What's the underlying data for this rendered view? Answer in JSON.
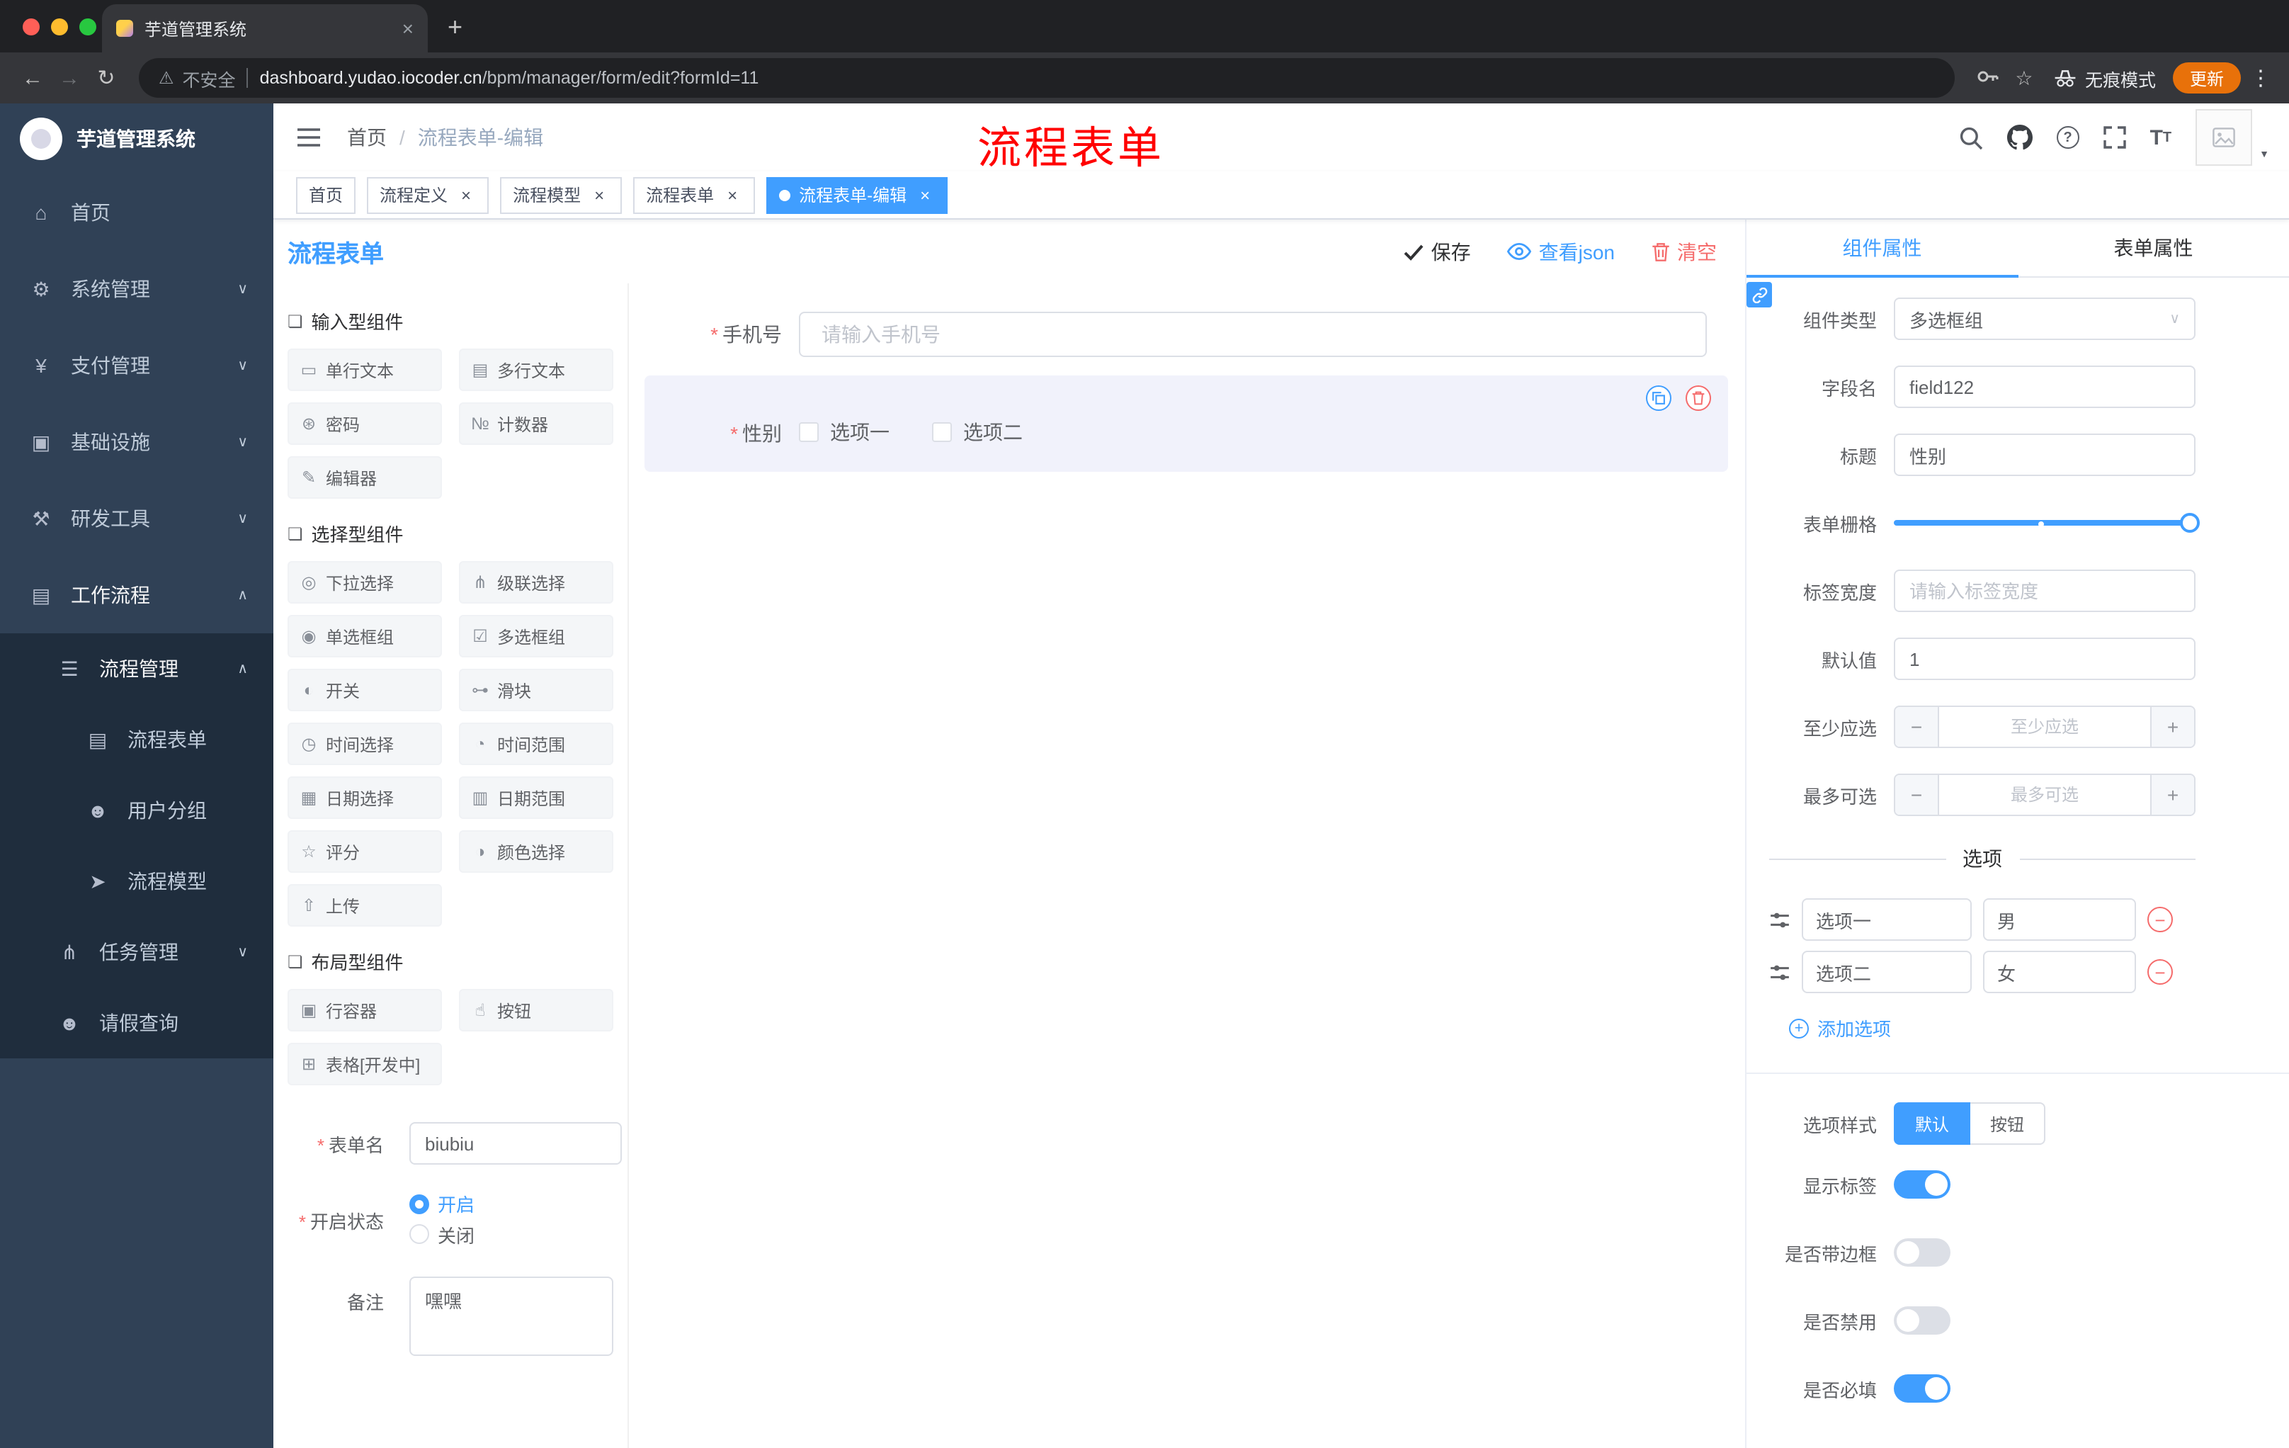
{
  "browser": {
    "tab": {
      "title": "芋道管理系统",
      "close": "×"
    },
    "new_tab": "+",
    "security": "不安全",
    "url_domain": "dashboard.yudao.iocoder.cn",
    "url_path": "/bpm/manager/form/edit?formId=11",
    "incognito": "无痕模式",
    "update": "更新"
  },
  "sidebar": {
    "logo_title": "芋道管理系统",
    "items": [
      {
        "id": "home",
        "label": "首页",
        "icon": "home-icon",
        "level": 1
      },
      {
        "id": "system-mgmt",
        "label": "系统管理",
        "icon": "gear-icon",
        "level": 1,
        "chevron": "down"
      },
      {
        "id": "payment-mgmt",
        "label": "支付管理",
        "icon": "payment-icon",
        "level": 1,
        "chevron": "down"
      },
      {
        "id": "infrastructure",
        "label": "基础设施",
        "icon": "infrastructure-icon",
        "level": 1,
        "chevron": "down"
      },
      {
        "id": "dev-tools",
        "label": "研发工具",
        "icon": "tools-icon",
        "level": 1,
        "chevron": "down"
      },
      {
        "id": "workflow",
        "label": "工作流程",
        "icon": "workflow-icon",
        "level": 1,
        "chevron": "up",
        "bright": true
      },
      {
        "id": "process-mgmt",
        "label": "流程管理",
        "icon": "list-icon",
        "level": 2,
        "chevron": "up",
        "bright": true
      },
      {
        "id": "process-form",
        "label": "流程表单",
        "icon": "form-icon",
        "level": 3
      },
      {
        "id": "user-group",
        "label": "用户分组",
        "icon": "users-icon",
        "level": 3
      },
      {
        "id": "process-model",
        "label": "流程模型",
        "icon": "model-icon",
        "level": 3
      },
      {
        "id": "task-mgmt",
        "label": "任务管理",
        "icon": "tasks-icon",
        "level": 2,
        "chevron": "down"
      },
      {
        "id": "leave-query",
        "label": "请假查询",
        "icon": "user-icon",
        "level": 2
      }
    ]
  },
  "header": {
    "breadcrumb": [
      "首页",
      "流程表单-编辑"
    ],
    "annotation": "流程表单"
  },
  "tags": [
    {
      "id": "home",
      "label": "首页",
      "closable": false,
      "active": false
    },
    {
      "id": "process-definition",
      "label": "流程定义",
      "closable": true,
      "active": false
    },
    {
      "id": "process-model",
      "label": "流程模型",
      "closable": true,
      "active": false
    },
    {
      "id": "process-form",
      "label": "流程表单",
      "closable": true,
      "active": false
    },
    {
      "id": "process-form-edit",
      "label": "流程表单-编辑",
      "closable": true,
      "active": true
    }
  ],
  "designer": {
    "title": "流程表单",
    "actions": {
      "save": "保存",
      "view_json": "查看json",
      "clear": "清空"
    },
    "component_sections": [
      {
        "title": "输入型组件",
        "items": [
          {
            "id": "single-text",
            "label": "单行文本",
            "icon": "input-icon"
          },
          {
            "id": "multi-text",
            "label": "多行文本",
            "icon": "textarea-icon"
          },
          {
            "id": "password",
            "label": "密码",
            "icon": "password-icon"
          },
          {
            "id": "counter",
            "label": "计数器",
            "icon": "counter-icon"
          },
          {
            "id": "editor",
            "label": "编辑器",
            "icon": "editor-icon"
          }
        ]
      },
      {
        "title": "选择型组件",
        "items": [
          {
            "id": "select",
            "label": "下拉选择",
            "icon": "select-icon"
          },
          {
            "id": "cascader",
            "label": "级联选择",
            "icon": "cascader-icon"
          },
          {
            "id": "radio-group",
            "label": "单选框组",
            "icon": "radio-icon"
          },
          {
            "id": "checkbox-group",
            "label": "多选框组",
            "icon": "checkbox-icon"
          },
          {
            "id": "switch",
            "label": "开关",
            "icon": "switch-icon"
          },
          {
            "id": "slider",
            "label": "滑块",
            "icon": "slider-icon"
          },
          {
            "id": "time-picker",
            "label": "时间选择",
            "icon": "time-icon"
          },
          {
            "id": "time-range",
            "label": "时间范围",
            "icon": "time-range-icon"
          },
          {
            "id": "date-picker",
            "label": "日期选择",
            "icon": "date-icon"
          },
          {
            "id": "date-range",
            "label": "日期范围",
            "icon": "date-range-icon"
          },
          {
            "id": "rate",
            "label": "评分",
            "icon": "rate-icon"
          },
          {
            "id": "color-picker",
            "label": "颜色选择",
            "icon": "color-icon"
          },
          {
            "id": "upload",
            "label": "上传",
            "icon": "upload-icon"
          }
        ]
      },
      {
        "title": "布局型组件",
        "items": [
          {
            "id": "row-container",
            "label": "行容器",
            "icon": "row-icon"
          },
          {
            "id": "button",
            "label": "按钮",
            "icon": "button-icon"
          },
          {
            "id": "table",
            "label": "表格[开发中]",
            "icon": "table-icon"
          }
        ]
      }
    ],
    "form_meta": {
      "name_label": "表单名",
      "name_value": "biubiu",
      "status_label": "开启状态",
      "status_options": [
        "开启",
        "关闭"
      ],
      "status_selected": "开启",
      "remark_label": "备注",
      "remark_value": "嘿嘿"
    },
    "canvas": {
      "phone": {
        "label": "手机号",
        "placeholder": "请输入手机号",
        "required": true
      },
      "gender": {
        "label": "性别",
        "required": true,
        "options": [
          "选项一",
          "选项二"
        ]
      }
    }
  },
  "props": {
    "tabs": [
      {
        "id": "component-props",
        "label": "组件属性",
        "active": true
      },
      {
        "id": "form-props",
        "label": "表单属性",
        "active": false
      }
    ],
    "rows": {
      "component_type": {
        "label": "组件类型",
        "value": "多选框组"
      },
      "field_name": {
        "label": "字段名",
        "value": "field122"
      },
      "title": {
        "label": "标题",
        "value": "性别"
      },
      "grid": {
        "label": "表单栅格"
      },
      "label_width": {
        "label": "标签宽度",
        "placeholder": "请输入标签宽度"
      },
      "default_value": {
        "label": "默认值",
        "value": "1"
      },
      "min_select": {
        "label": "至少应选",
        "placeholder": "至少应选"
      },
      "max_select": {
        "label": "最多可选",
        "placeholder": "最多可选"
      }
    },
    "options_section": {
      "title": "选项",
      "options": [
        {
          "name": "选项一",
          "value": "男"
        },
        {
          "name": "选项二",
          "value": "女"
        }
      ],
      "add_option": "添加选项"
    },
    "style_row": {
      "label": "选项样式",
      "options": [
        "默认",
        "按钮"
      ],
      "selected": "默认"
    },
    "switch_rows": [
      {
        "id": "show-label",
        "label": "显示标签",
        "on": true
      },
      {
        "id": "with-border",
        "label": "是否带边框",
        "on": false
      },
      {
        "id": "disabled",
        "label": "是否禁用",
        "on": false
      },
      {
        "id": "required",
        "label": "是否必填",
        "on": true
      }
    ]
  },
  "colors": {
    "accent": "#409eff",
    "danger": "#f56c6c",
    "sidebar_bg": "#304156",
    "submenu_bg": "#1f2d3d",
    "annotation": "#ff0000",
    "update_pill": "#e8710a",
    "selected_widget_bg": "#f1f2fb"
  }
}
